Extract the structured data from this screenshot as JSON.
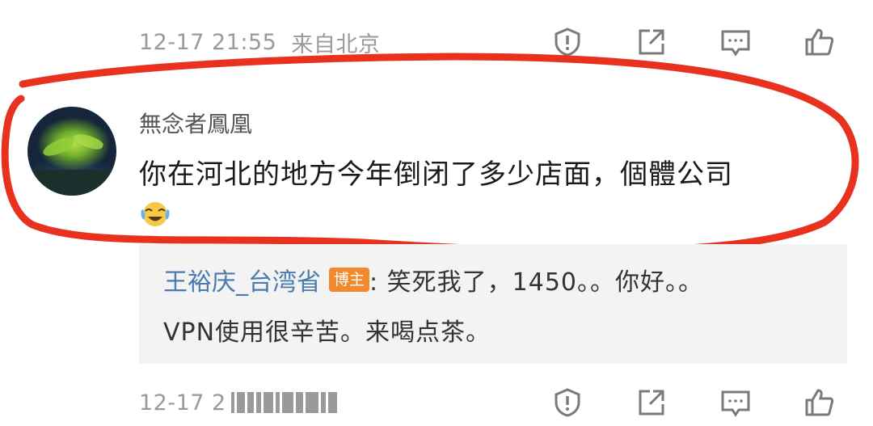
{
  "top_comment_meta": {
    "time": "12-17 21:55",
    "location": "来自北京"
  },
  "comment": {
    "username": "無念者鳳凰",
    "text": "你在河北的地方今年倒闭了多少店面，個體公司",
    "emoji": "laughing-crying-emoji"
  },
  "reply": {
    "username": "王裕庆_台湾省",
    "badge": "博主",
    "line1": ": 笑死我了，1450。。你好。。",
    "line2": "VPN使用很辛苦。来喝点茶。"
  },
  "bottom_meta": {
    "time_partial": "12-17 2"
  },
  "actions": [
    "report-icon",
    "repost-icon",
    "comment-icon",
    "like-icon"
  ],
  "colors": {
    "annotation": "#e8321f",
    "reply_user": "#4a7bb0",
    "badge": "#f08a2c",
    "meta": "#9a9a9a"
  }
}
